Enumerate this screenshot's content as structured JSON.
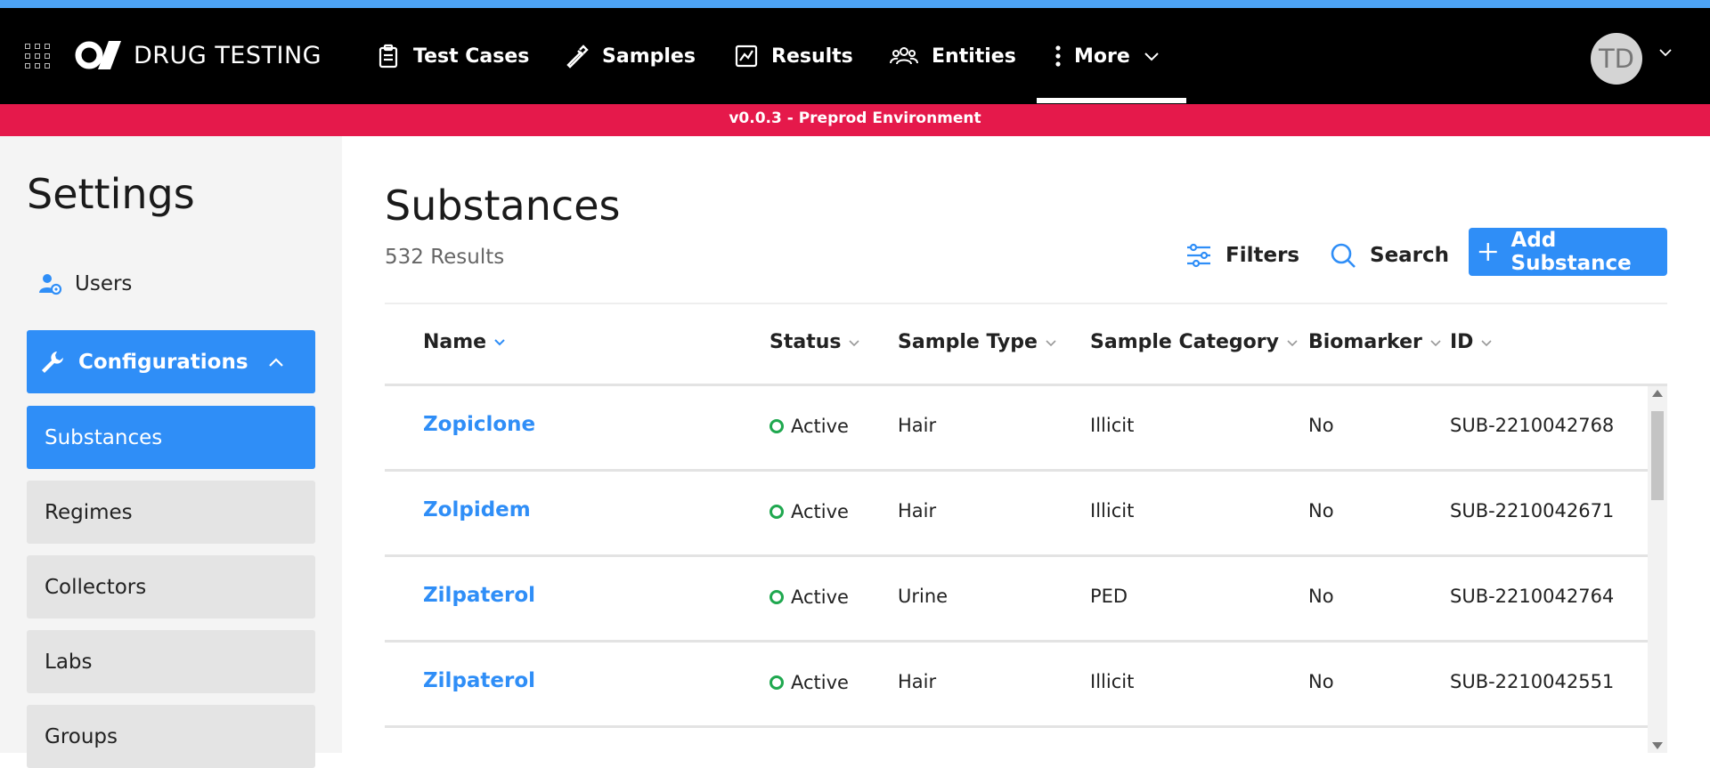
{
  "app": {
    "brand": "DRUG TESTING",
    "accent_color": "#4da3f5",
    "primary_color": "#2f8ef7",
    "env_color": "#e5194b"
  },
  "nav": {
    "items": [
      {
        "label": "Test Cases",
        "icon": "clipboard-icon"
      },
      {
        "label": "Samples",
        "icon": "pipette-icon"
      },
      {
        "label": "Results",
        "icon": "chart-icon"
      },
      {
        "label": "Entities",
        "icon": "people-icon"
      },
      {
        "label": "More",
        "icon": "more-vertical-icon"
      }
    ],
    "active": "More"
  },
  "user": {
    "initials": "TD"
  },
  "environment": {
    "text": "v0.0.3 - Preprod Environment"
  },
  "sidebar": {
    "title": "Settings",
    "users_label": "Users",
    "configurations_label": "Configurations",
    "items": [
      {
        "label": "Substances",
        "active": true
      },
      {
        "label": "Regimes",
        "active": false
      },
      {
        "label": "Collectors",
        "active": false
      },
      {
        "label": "Labs",
        "active": false
      },
      {
        "label": "Groups",
        "active": false
      }
    ]
  },
  "main": {
    "title": "Substances",
    "results_count": "532 Results",
    "filters_label": "Filters",
    "search_label": "Search",
    "add_label": "Add Substance"
  },
  "table": {
    "columns": [
      "Name",
      "Status",
      "Sample Type",
      "Sample Category",
      "Biomarker",
      "ID"
    ],
    "sorted_column": "Name",
    "rows": [
      {
        "name": "Zopiclone",
        "status": "Active",
        "sample_type": "Hair",
        "sample_category": "Illicit",
        "biomarker": "No",
        "id": "SUB-2210042768"
      },
      {
        "name": "Zolpidem",
        "status": "Active",
        "sample_type": "Hair",
        "sample_category": "Illicit",
        "biomarker": "No",
        "id": "SUB-2210042671"
      },
      {
        "name": "Zilpaterol",
        "status": "Active",
        "sample_type": "Urine",
        "sample_category": "PED",
        "biomarker": "No",
        "id": "SUB-2210042764"
      },
      {
        "name": "Zilpaterol",
        "status": "Active",
        "sample_type": "Hair",
        "sample_category": "Illicit",
        "biomarker": "No",
        "id": "SUB-2210042551"
      }
    ]
  }
}
